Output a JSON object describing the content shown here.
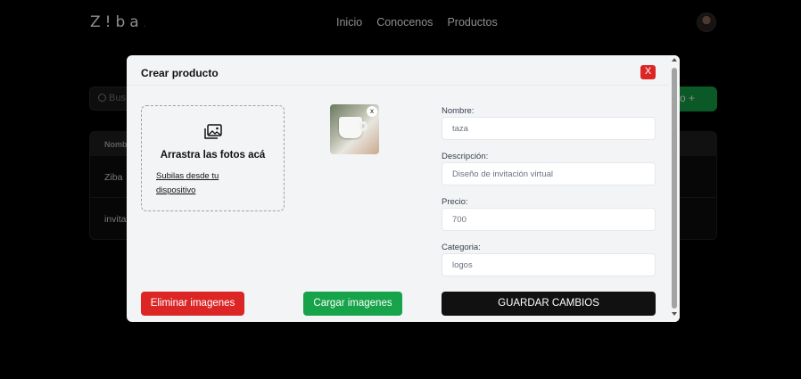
{
  "header": {
    "logo": "Z!ba",
    "logo_dot": ".",
    "nav": [
      "Inicio",
      "Conocenos",
      "Productos"
    ]
  },
  "background": {
    "search_placeholder": "Bus",
    "add_button": "o +",
    "table_header": "Nomb",
    "rows": [
      "Ziba",
      "invita"
    ]
  },
  "modal": {
    "title": "Crear producto",
    "close_label": "X",
    "dropzone": {
      "title": "Arrastra las fotos acá",
      "link": "Subilas desde tu dispositivo"
    },
    "thumbnail_remove": "x",
    "fields": {
      "nombre": {
        "label": "Nombre:",
        "value": "taza"
      },
      "descripcion": {
        "label": "Descripción:",
        "value": "Diseño de invitación virtual"
      },
      "precio": {
        "label": "Precio:",
        "value": "700"
      },
      "categoria": {
        "label": "Categoria:",
        "value": "logos"
      }
    },
    "buttons": {
      "delete": "Eliminar imagenes",
      "upload": "Cargar imagenes",
      "save": "GUARDAR CAMBIOS"
    }
  },
  "colors": {
    "accent_green": "#16a34a",
    "danger_red": "#dc2626",
    "primary_dark": "#111111"
  },
  "icons": {
    "dropzone": "images-icon",
    "search": "search-icon"
  }
}
